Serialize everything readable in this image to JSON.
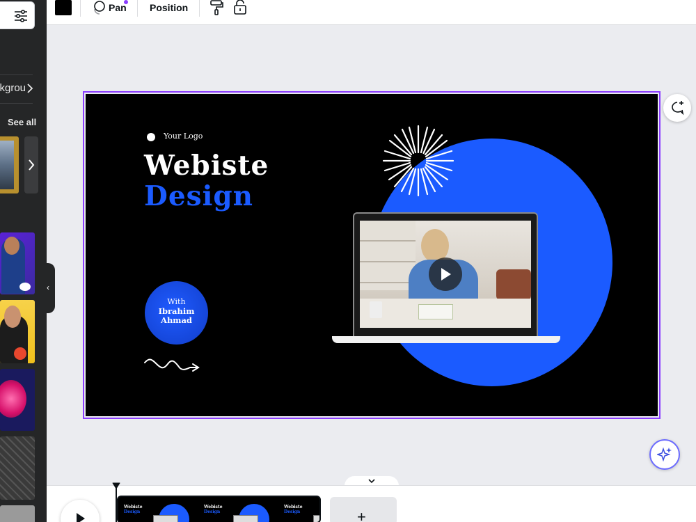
{
  "sidebar": {
    "category_chip": "ckgrou",
    "see_all": "See all",
    "collapse_icon": "‹"
  },
  "toolbar": {
    "text_color": "#000000",
    "pan_label": "Pan",
    "position_label": "Position"
  },
  "canvas": {
    "logo_text": "Your Logo",
    "title_line1": "Webiste",
    "title_line2": "Design",
    "with_label": "With",
    "presenter_first": "Ibrahim",
    "presenter_last": "Ahmad",
    "accent_color": "#1b5bff",
    "selection_color": "#8b3dff"
  },
  "timeline": {
    "clip_frames": [
      {
        "title1": "Webiste",
        "title2": "Design"
      },
      {
        "title1": "Webiste",
        "title2": "Design"
      },
      {
        "title1": "Webiste",
        "title2": "Design"
      }
    ],
    "add_page_label": "+"
  }
}
